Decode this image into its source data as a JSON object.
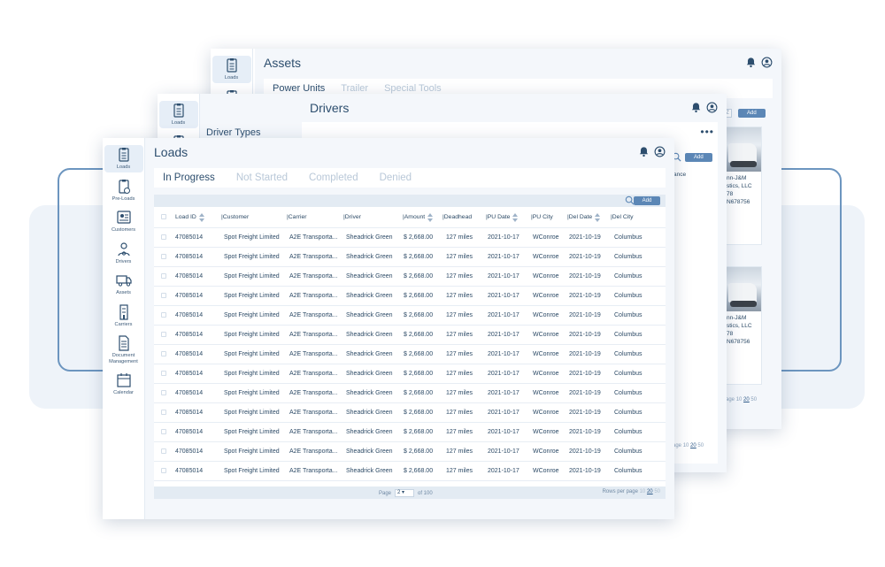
{
  "nav": [
    {
      "key": "loads",
      "label": "Loads"
    },
    {
      "key": "pre-loads",
      "label": "Pre-Loads"
    },
    {
      "key": "customers",
      "label": "Customers"
    },
    {
      "key": "drivers",
      "label": "Drivers"
    },
    {
      "key": "assets",
      "label": "Assets"
    },
    {
      "key": "carriers",
      "label": "Carriers"
    },
    {
      "key": "documents",
      "label": "Document Management"
    },
    {
      "key": "calendar",
      "label": "Calendar"
    }
  ],
  "assets_window": {
    "title": "Assets",
    "tabs": [
      "Power Units",
      "Trailer",
      "Special Tools"
    ],
    "add_label": "Add",
    "chip_label": "Z",
    "cards": [
      {
        "company": "nn-J&M",
        "company2": "stics, LLC",
        "line3": "78",
        "line4": "N678756"
      },
      {
        "company": "nn-J&M",
        "company2": "stics, LLC",
        "line3": "78",
        "line4": "N678756"
      }
    ],
    "pager": {
      "prefix": "age",
      "opt1": "10",
      "selected": "20",
      "opt3": "50"
    }
  },
  "drivers_window": {
    "title": "Drivers",
    "sidebar_heading": "Driver Types",
    "more_label": "•••",
    "add_label": "Add",
    "column_partial": "ance",
    "pager": {
      "prefix": "age",
      "opt1": "10",
      "selected": "20",
      "opt3": "50"
    }
  },
  "loads_window": {
    "title": "Loads",
    "tabs": [
      "In Progress",
      "Not Started",
      "Completed",
      "Denied"
    ],
    "add_label": "Add",
    "columns": [
      "Load ID",
      "Customer",
      "Carrier",
      "Driver",
      "Amount",
      "Deadhead",
      "PU Date",
      "PU City",
      "Del Date",
      "Del City"
    ],
    "rows": [
      [
        "47085014",
        "Spot Freight Limited",
        "A2E Transporta...",
        "Sheadrick Green",
        "$ 2,668.00",
        "127 miles",
        "2021-10-17",
        "WConroe",
        "2021-10-19",
        "Columbus"
      ],
      [
        "47085014",
        "Spot Freight Limited",
        "A2E Transporta...",
        "Sheadrick Green",
        "$ 2,668.00",
        "127 miles",
        "2021-10-17",
        "WConroe",
        "2021-10-19",
        "Columbus"
      ],
      [
        "47085014",
        "Spot Freight Limited",
        "A2E Transporta...",
        "Sheadrick Green",
        "$ 2,668.00",
        "127 miles",
        "2021-10-17",
        "WConroe",
        "2021-10-19",
        "Columbus"
      ],
      [
        "47085014",
        "Spot Freight Limited",
        "A2E Transporta...",
        "Sheadrick Green",
        "$ 2,668.00",
        "127 miles",
        "2021-10-17",
        "WConroe",
        "2021-10-19",
        "Columbus"
      ],
      [
        "47085014",
        "Spot Freight Limited",
        "A2E Transporta...",
        "Sheadrick Green",
        "$ 2,668.00",
        "127 miles",
        "2021-10-17",
        "WConroe",
        "2021-10-19",
        "Columbus"
      ],
      [
        "47085014",
        "Spot Freight Limited",
        "A2E Transporta...",
        "Sheadrick Green",
        "$ 2,668.00",
        "127 miles",
        "2021-10-17",
        "WConroe",
        "2021-10-19",
        "Columbus"
      ],
      [
        "47085014",
        "Spot Freight Limited",
        "A2E Transporta...",
        "Sheadrick Green",
        "$ 2,668.00",
        "127 miles",
        "2021-10-17",
        "WConroe",
        "2021-10-19",
        "Columbus"
      ],
      [
        "47085014",
        "Spot Freight Limited",
        "A2E Transporta...",
        "Sheadrick Green",
        "$ 2,668.00",
        "127 miles",
        "2021-10-17",
        "WConroe",
        "2021-10-19",
        "Columbus"
      ],
      [
        "47085014",
        "Spot Freight Limited",
        "A2E Transporta...",
        "Sheadrick Green",
        "$ 2,668.00",
        "127 miles",
        "2021-10-17",
        "WConroe",
        "2021-10-19",
        "Columbus"
      ],
      [
        "47085014",
        "Spot Freight Limited",
        "A2E Transporta...",
        "Sheadrick Green",
        "$ 2,668.00",
        "127 miles",
        "2021-10-17",
        "WConroe",
        "2021-10-19",
        "Columbus"
      ],
      [
        "47085014",
        "Spot Freight Limited",
        "A2E Transporta...",
        "Sheadrick Green",
        "$ 2,668.00",
        "127 miles",
        "2021-10-17",
        "WConroe",
        "2021-10-19",
        "Columbus"
      ],
      [
        "47085014",
        "Spot Freight Limited",
        "A2E Transporta...",
        "Sheadrick Green",
        "$ 2,668.00",
        "127 miles",
        "2021-10-17",
        "WConroe",
        "2021-10-19",
        "Columbus"
      ],
      [
        "47085014",
        "Spot Freight Limited",
        "A2E Transporta...",
        "Sheadrick Green",
        "$ 2,668.00",
        "127 miles",
        "2021-10-17",
        "WConroe",
        "2021-10-19",
        "Columbus"
      ]
    ],
    "footer": {
      "page_label": "Page",
      "page_value": "2 ▾",
      "page_total": "of 100",
      "rows_label": "Rows per page",
      "opt1": "10",
      "selected": "20",
      "opt3": "50"
    }
  },
  "colors": {
    "accent": "#5c87b6",
    "text": "#2c4a66",
    "panel": "#f4f7fb",
    "muted": "#b9c8d8"
  }
}
